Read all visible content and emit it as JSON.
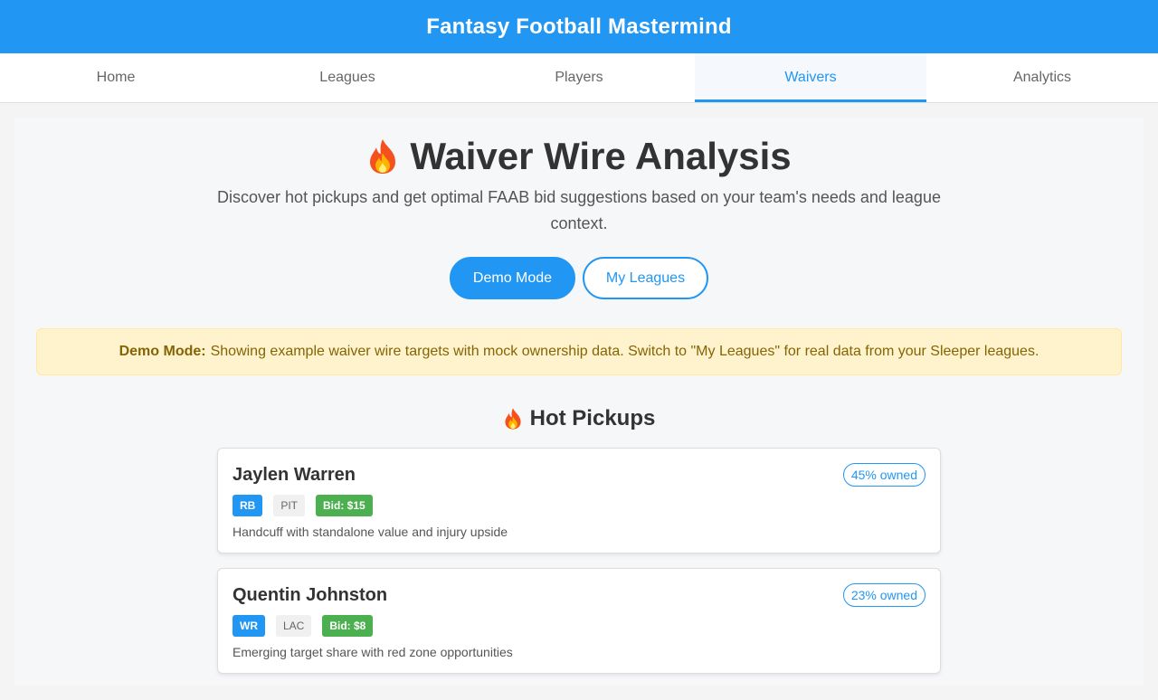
{
  "app": {
    "title": "Fantasy Football Mastermind"
  },
  "nav": {
    "tabs": [
      {
        "label": "Home",
        "active": false
      },
      {
        "label": "Leagues",
        "active": false
      },
      {
        "label": "Players",
        "active": false
      },
      {
        "label": "Waivers",
        "active": true
      },
      {
        "label": "Analytics",
        "active": false
      }
    ]
  },
  "page": {
    "title": "Waiver Wire Analysis",
    "title_icon": "fire-icon",
    "subtitle": "Discover hot pickups and get optimal FAAB bid suggestions based on your team's needs and league context."
  },
  "mode_buttons": {
    "demo_label": "Demo Mode",
    "leagues_label": "My Leagues",
    "active": "Demo Mode"
  },
  "notice": {
    "strong": "Demo Mode:",
    "text": "Showing example waiver wire targets with mock ownership data. Switch to \"My Leagues\" for real data from your Sleeper leagues."
  },
  "hot_pickups": {
    "title": "Hot Pickups",
    "icon": "fire-icon",
    "players": [
      {
        "name": "Jaylen Warren",
        "owned": "45% owned",
        "position": "RB",
        "team": "PIT",
        "bid": "Bid: $15",
        "note": "Handcuff with standalone value and injury upside"
      },
      {
        "name": "Quentin Johnston",
        "owned": "23% owned",
        "position": "WR",
        "team": "LAC",
        "bid": "Bid: $8",
        "note": "Emerging target share with red zone opportunities"
      }
    ]
  },
  "colors": {
    "brand": "#2196f3",
    "bid": "#4caf50",
    "notice_bg": "#fff3cd",
    "notice_text": "#856404"
  }
}
